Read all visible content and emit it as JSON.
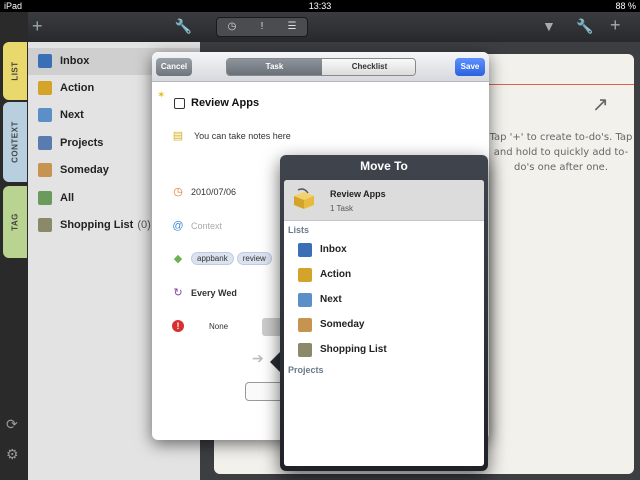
{
  "status": {
    "carrier": "iPad",
    "time": "13:33",
    "battery": "88 %"
  },
  "tabs": {
    "list": "LIST",
    "context": "CONTEXT",
    "tag": "TAG"
  },
  "sidebar": {
    "items": [
      {
        "label": "Inbox",
        "icon": "inbox-icon",
        "color": "#3b6fb5",
        "count": ""
      },
      {
        "label": "Action",
        "icon": "action-icon",
        "color": "#d4a32a",
        "count": ""
      },
      {
        "label": "Next",
        "icon": "next-icon",
        "color": "#5b8fc8",
        "count": ""
      },
      {
        "label": "Projects",
        "icon": "projects-icon",
        "color": "#5a7bb0",
        "count": ""
      },
      {
        "label": "Someday",
        "icon": "someday-icon",
        "color": "#c79350",
        "count": ""
      },
      {
        "label": "All",
        "icon": "all-icon",
        "color": "#6a9a5c",
        "count": ""
      },
      {
        "label": "Shopping List",
        "icon": "shopping-list-icon",
        "color": "#8a8a6a",
        "count": "(0)"
      }
    ]
  },
  "main": {
    "hint": "Tap '+' to create to-do's. Tap and hold to quickly add to-do's one after one."
  },
  "dialog": {
    "cancel": "Cancel",
    "save": "Save",
    "tab_task": "Task",
    "tab_checklist": "Checklist",
    "title": "Review Apps",
    "notes": "You can take notes here",
    "date": "2010/07/06",
    "context_placeholder": "Context",
    "tags": [
      "appbank",
      "review"
    ],
    "repeat": "Every Wed",
    "priority": "None"
  },
  "popover": {
    "title": "Move To",
    "current_name": "Review Apps",
    "current_count": "1 Task",
    "section_lists": "Lists",
    "section_projects": "Projects",
    "items": [
      {
        "label": "Inbox",
        "icon": "inbox-icon",
        "color": "#3b6fb5"
      },
      {
        "label": "Action",
        "icon": "action-icon",
        "color": "#d4a32a"
      },
      {
        "label": "Next",
        "icon": "next-icon",
        "color": "#5b8fc8"
      },
      {
        "label": "Someday",
        "icon": "someday-icon",
        "color": "#c79350"
      },
      {
        "label": "Shopping List",
        "icon": "shopping-list-icon",
        "color": "#8a8a6a"
      }
    ]
  }
}
